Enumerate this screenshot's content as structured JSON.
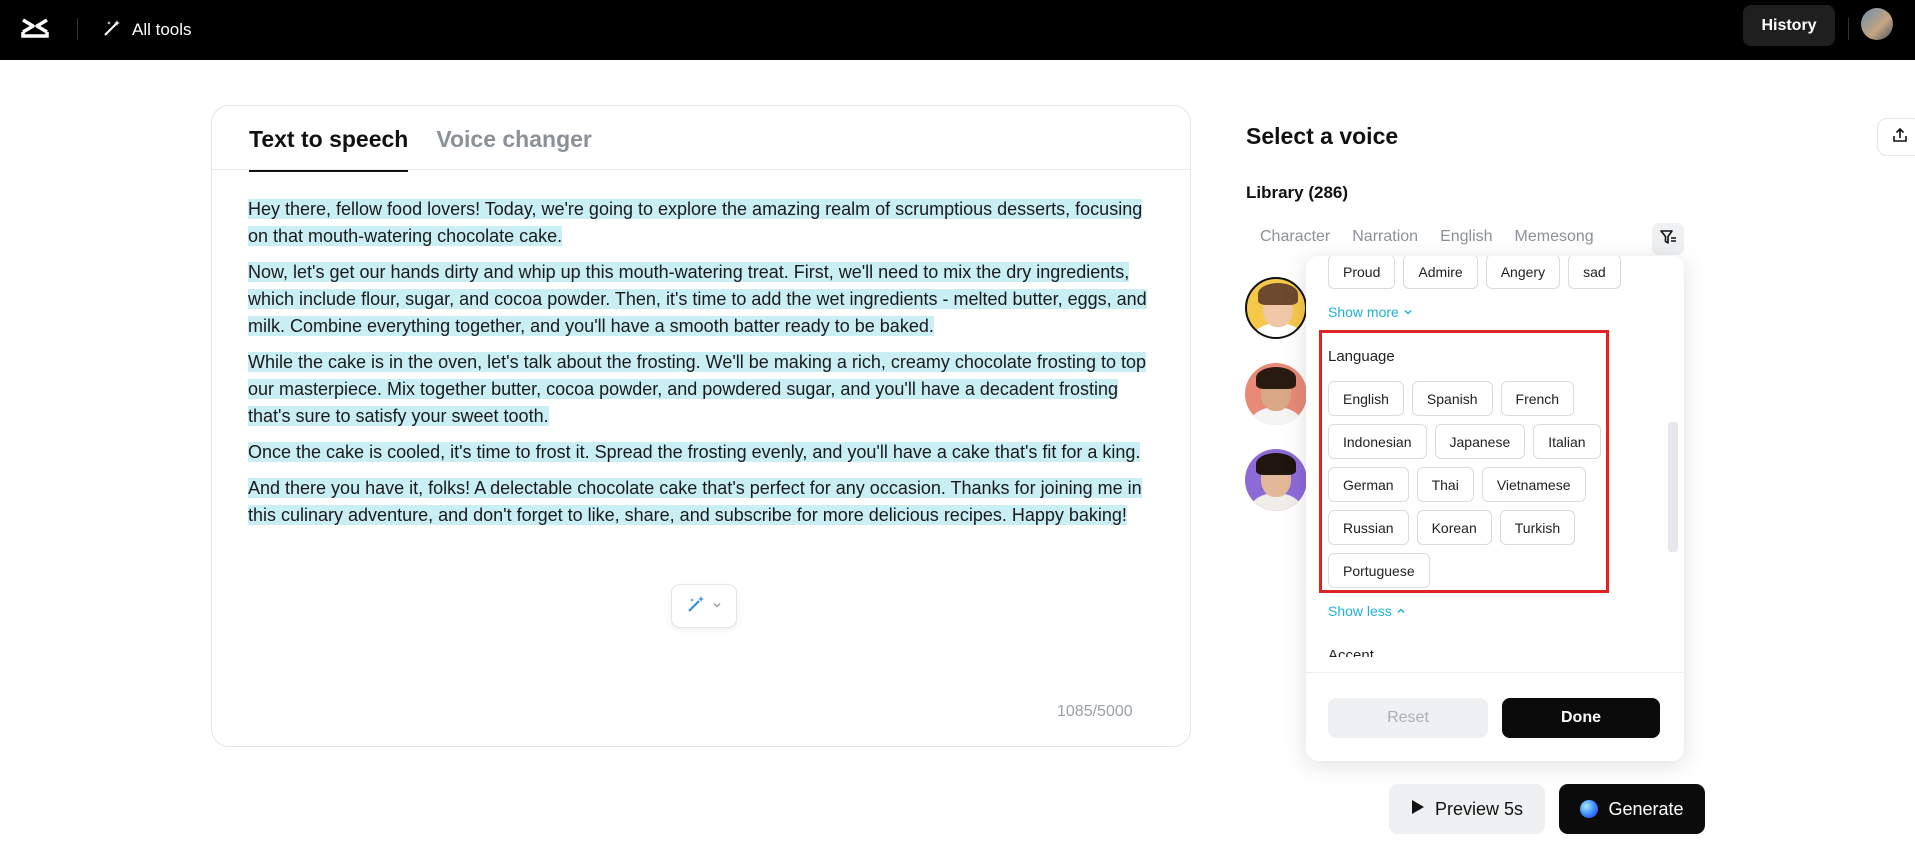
{
  "topbar": {
    "all_tools_label": "All tools",
    "history_label": "History"
  },
  "editor": {
    "tabs": [
      {
        "label": "Text to speech",
        "active": true
      },
      {
        "label": "Voice changer",
        "active": false
      }
    ],
    "paragraphs": [
      "Hey there, fellow food lovers! Today, we're going to explore the amazing realm of scrumptious desserts, focusing on that mouth-watering chocolate cake.",
      "Now, let's get our hands dirty and whip up this mouth-watering treat. First, we'll need to mix the dry ingredients, which include flour, sugar, and cocoa powder. Then, it's time to add the wet ingredients - melted butter, eggs, and milk. Combine everything together, and you'll have a smooth batter ready to be baked.",
      "While the cake is in the oven, let's talk about the frosting. We'll be making a rich, creamy chocolate frosting to top our masterpiece. Mix together butter, cocoa powder, and powdered sugar, and you'll have a decadent frosting that's sure to satisfy your sweet tooth.",
      "Once the cake is cooled, it's time to frost it. Spread the frosting evenly, and you'll have a cake that's fit for a king.",
      "And there you have it, folks! A delectable chocolate cake that's perfect for any occasion. Thanks for joining me in this culinary adventure, and don't forget to like, share, and subscribe for more delicious recipes. Happy baking!"
    ],
    "char_count": "1085/5000"
  },
  "voice_panel": {
    "title": "Select a voice",
    "library_label": "Library (286)",
    "categories": [
      "Character",
      "Narration",
      "English",
      "Memesong"
    ]
  },
  "filter_popover": {
    "emotions": [
      "Proud",
      "Admire",
      "Angery",
      "sad"
    ],
    "show_more_label": "Show more",
    "language_title": "Language",
    "languages": [
      [
        "English",
        "Spanish",
        "French"
      ],
      [
        "Indonesian",
        "Japanese",
        "Italian"
      ],
      [
        "German",
        "Thai",
        "Vietnamese"
      ],
      [
        "Russian",
        "Korean",
        "Turkish"
      ],
      [
        "Portuguese"
      ]
    ],
    "show_less_label": "Show less",
    "accent_title": "Accent",
    "reset_label": "Reset",
    "done_label": "Done"
  },
  "actions": {
    "preview_label": "Preview 5s",
    "generate_label": "Generate"
  },
  "colors": {
    "highlight": "#c9eff5",
    "link": "#20b2d8",
    "annotation_box": "#e02424"
  }
}
